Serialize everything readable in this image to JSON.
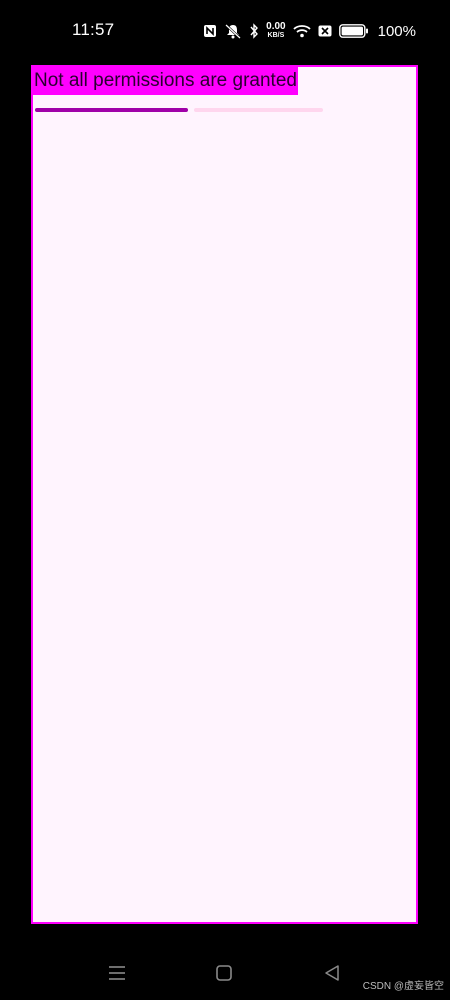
{
  "status_bar": {
    "time": "11:57",
    "net_speed_value": "0.00",
    "net_speed_unit": "KB/S",
    "battery_percent": "100%",
    "icons": [
      "nfc-icon",
      "mute-icon",
      "bluetooth-icon",
      "wifi-icon",
      "sim-off-icon",
      "battery-icon"
    ]
  },
  "app": {
    "message": "Not all permissions are granted",
    "progress": 0.53,
    "colors": {
      "frame_border": "#ff00ff",
      "background": "#fff4fe",
      "message_highlight": "#ff00ff",
      "progress_active": "#a000a8",
      "progress_track": "#ffd6ee"
    }
  },
  "nav_bar": {
    "buttons": [
      "menu-icon",
      "home-icon",
      "back-icon"
    ]
  },
  "watermark": "CSDN @虚妄皆空"
}
